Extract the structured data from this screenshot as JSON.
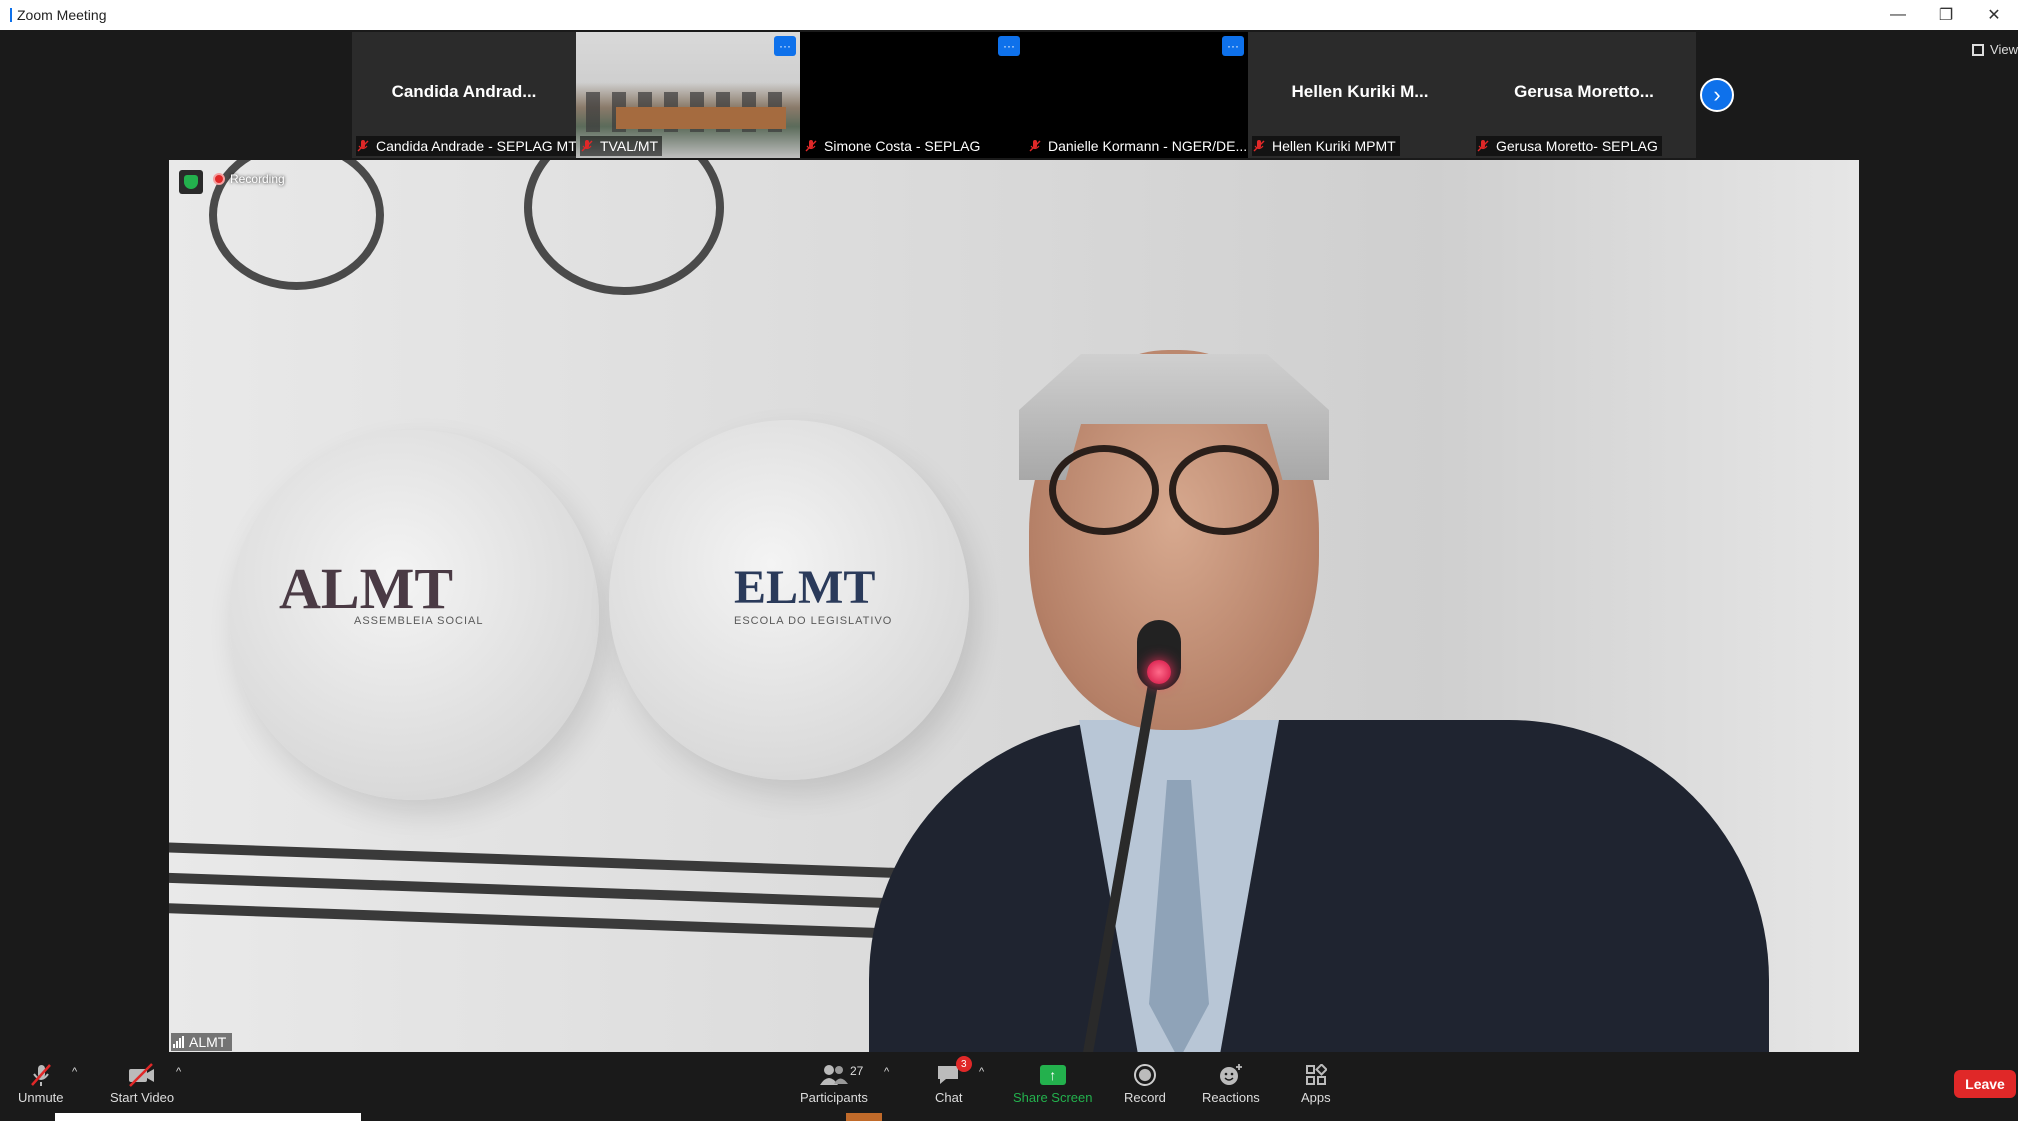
{
  "window": {
    "title": "Zoom Meeting",
    "controls": {
      "minimize": "—",
      "restore": "❐",
      "close": "✕"
    }
  },
  "gallery": {
    "tiles": [
      {
        "display_name": "Candida  Andrad...",
        "label": "Candida Andrade - SEPLAG MT",
        "video": "none"
      },
      {
        "display_name": "",
        "label": "TVAL/MT",
        "video": "photo",
        "more": "···"
      },
      {
        "display_name": "",
        "label": "Simone Costa - SEPLAG",
        "video": "black",
        "more": "···"
      },
      {
        "display_name": "",
        "label": "Danielle Kormann - NGER/DE...",
        "video": "black",
        "more": "···"
      },
      {
        "display_name": "Hellen Kuriki  M...",
        "label": "Hellen Kuriki MPMT",
        "video": "none"
      },
      {
        "display_name": "Gerusa  Moretto...",
        "label": "Gerusa Moretto- SEPLAG",
        "video": "none"
      }
    ],
    "next_icon": "›",
    "view_label": "View"
  },
  "main_video": {
    "recording_label": "Recording",
    "speaker_name": "ALMT",
    "wall_logos": {
      "left_title": "ALMT",
      "left_sub": "ASSEMBLEIA SOCIAL",
      "center_title": "ELMT",
      "center_sub": "ESCOLA DO LEGISLATIVO"
    }
  },
  "toolbar": {
    "unmute_label": "Unmute",
    "start_video_label": "Start Video",
    "participants_label": "Participants",
    "participants_count": "27",
    "chat_label": "Chat",
    "chat_badge": "3",
    "share_label": "Share Screen",
    "record_label": "Record",
    "reactions_label": "Reactions",
    "apps_label": "Apps",
    "leave_label": "Leave",
    "caret": "^"
  },
  "colors": {
    "accent": "#0e71eb",
    "share_green": "#23b14d",
    "leave_red": "#e02828",
    "background": "#1a1a1a"
  }
}
